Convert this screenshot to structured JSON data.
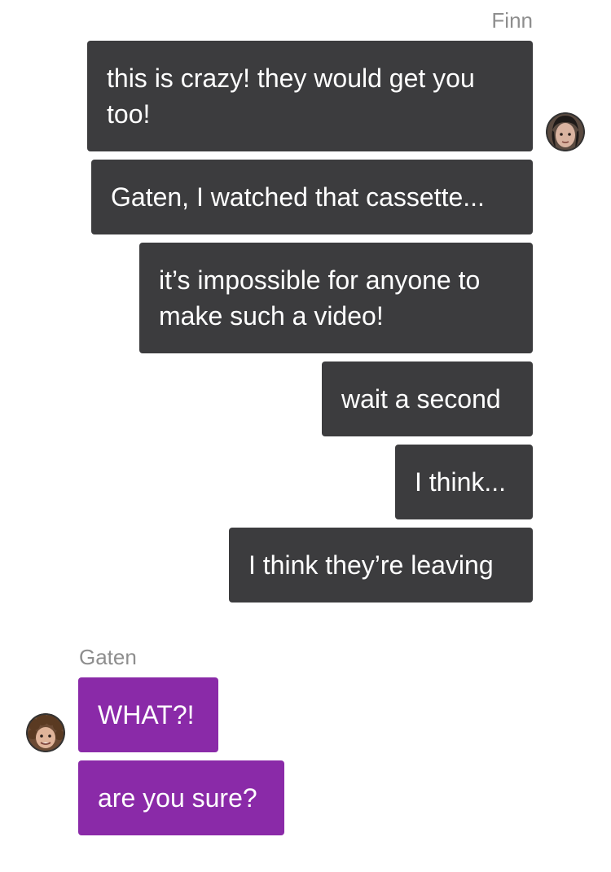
{
  "groups": [
    {
      "sender": "Finn",
      "messages": [
        "this is crazy! they would get you too!",
        "Gaten, I watched that cassette...",
        "it’s impossible for anyone to make such a video!",
        "wait a second",
        "I think...",
        "I think they’re leaving"
      ],
      "bubble_color": "#3c3c3e",
      "avatar_icon": "finn-avatar"
    },
    {
      "sender": "Gaten",
      "messages": [
        "WHAT?!",
        "are you sure?"
      ],
      "bubble_color": "#8a2aa8",
      "avatar_icon": "gaten-avatar"
    }
  ]
}
